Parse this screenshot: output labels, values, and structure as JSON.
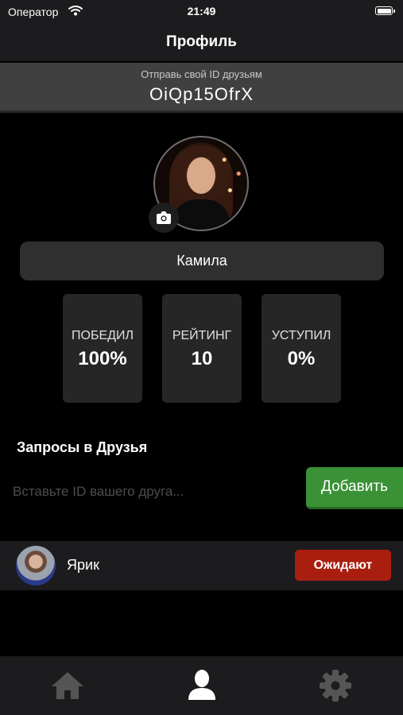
{
  "status_bar": {
    "carrier": "Оператор",
    "time": "21:49"
  },
  "nav": {
    "title": "Профиль"
  },
  "id_banner": {
    "caption": "Отправь свой ID друзьям",
    "id": "OiQp15OfrX"
  },
  "profile": {
    "name": "Камила"
  },
  "stats": [
    {
      "label": "ПОБЕДИЛ",
      "value": "100%"
    },
    {
      "label": "РЕЙТИНГ",
      "value": "10"
    },
    {
      "label": "УСТУПИЛ",
      "value": "0%"
    }
  ],
  "friend_requests": {
    "title": "Запросы в Друзья",
    "input_placeholder": "Вставьте ID вашего друга...",
    "add_label": "Добавить",
    "items": [
      {
        "name": "Ярик",
        "status": "Ожидают"
      }
    ]
  },
  "tabs": [
    {
      "icon": "home-icon",
      "active": false
    },
    {
      "icon": "profile-icon",
      "active": true
    },
    {
      "icon": "gear-icon",
      "active": false
    }
  ],
  "colors": {
    "add_button": "#3a9136",
    "pending_badge": "#aa1e10",
    "active_tab": "#ffffff",
    "inactive_tab": "#555555"
  }
}
